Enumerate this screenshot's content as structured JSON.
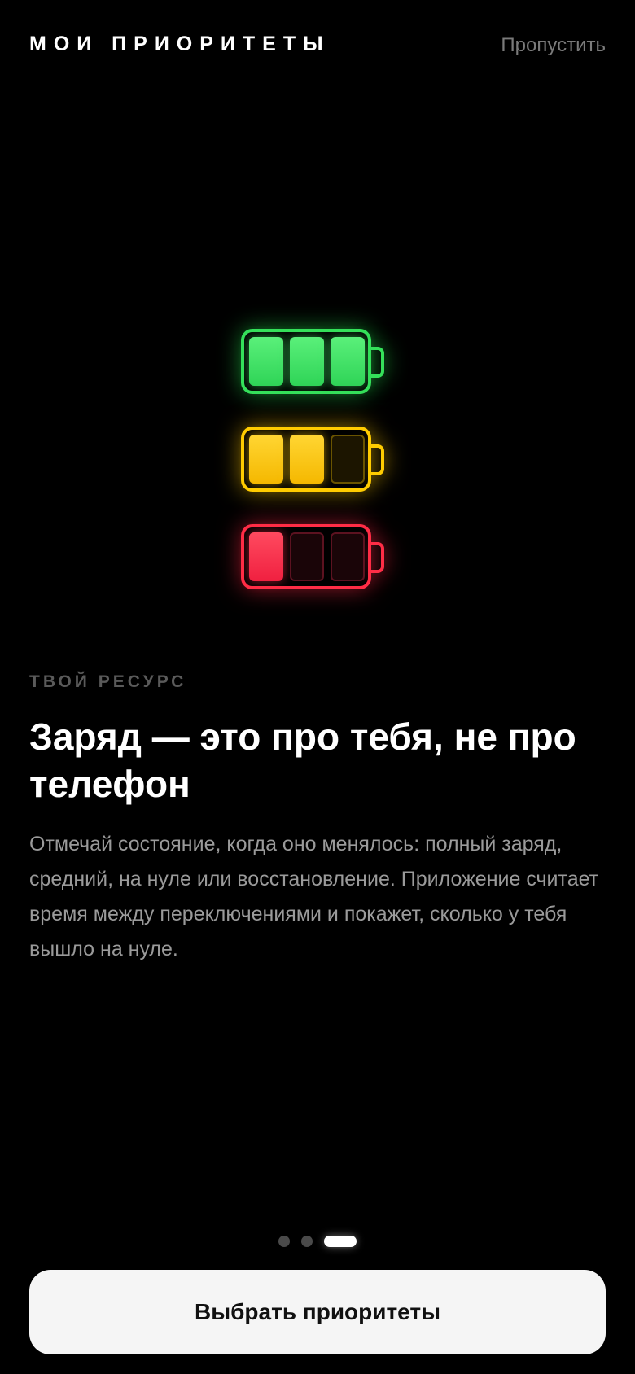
{
  "header": {
    "title": "МОИ ПРИОРИТЕТЫ",
    "skip_label": "Пропустить"
  },
  "illustration": {
    "batteries": [
      {
        "name": "battery-full",
        "color": "#35e05a",
        "filled_cells": 3,
        "total_cells": 3
      },
      {
        "name": "battery-medium",
        "color": "#ffcc00",
        "filled_cells": 2,
        "total_cells": 3
      },
      {
        "name": "battery-low",
        "color": "#ff2d46",
        "filled_cells": 1,
        "total_cells": 3
      }
    ]
  },
  "content": {
    "eyebrow": "ТВОЙ РЕСУРС",
    "headline": "Заряд — это про тебя, не про телефон",
    "body": "Отмечай состояние, когда оно менялось: полный заряд, средний, на нуле или восстановление. Приложение считает время между переключениями и покажет, сколько у тебя вышло на нуле."
  },
  "pager": {
    "total": 3,
    "active_index": 2
  },
  "cta": {
    "label": "Выбрать приоритеты"
  }
}
